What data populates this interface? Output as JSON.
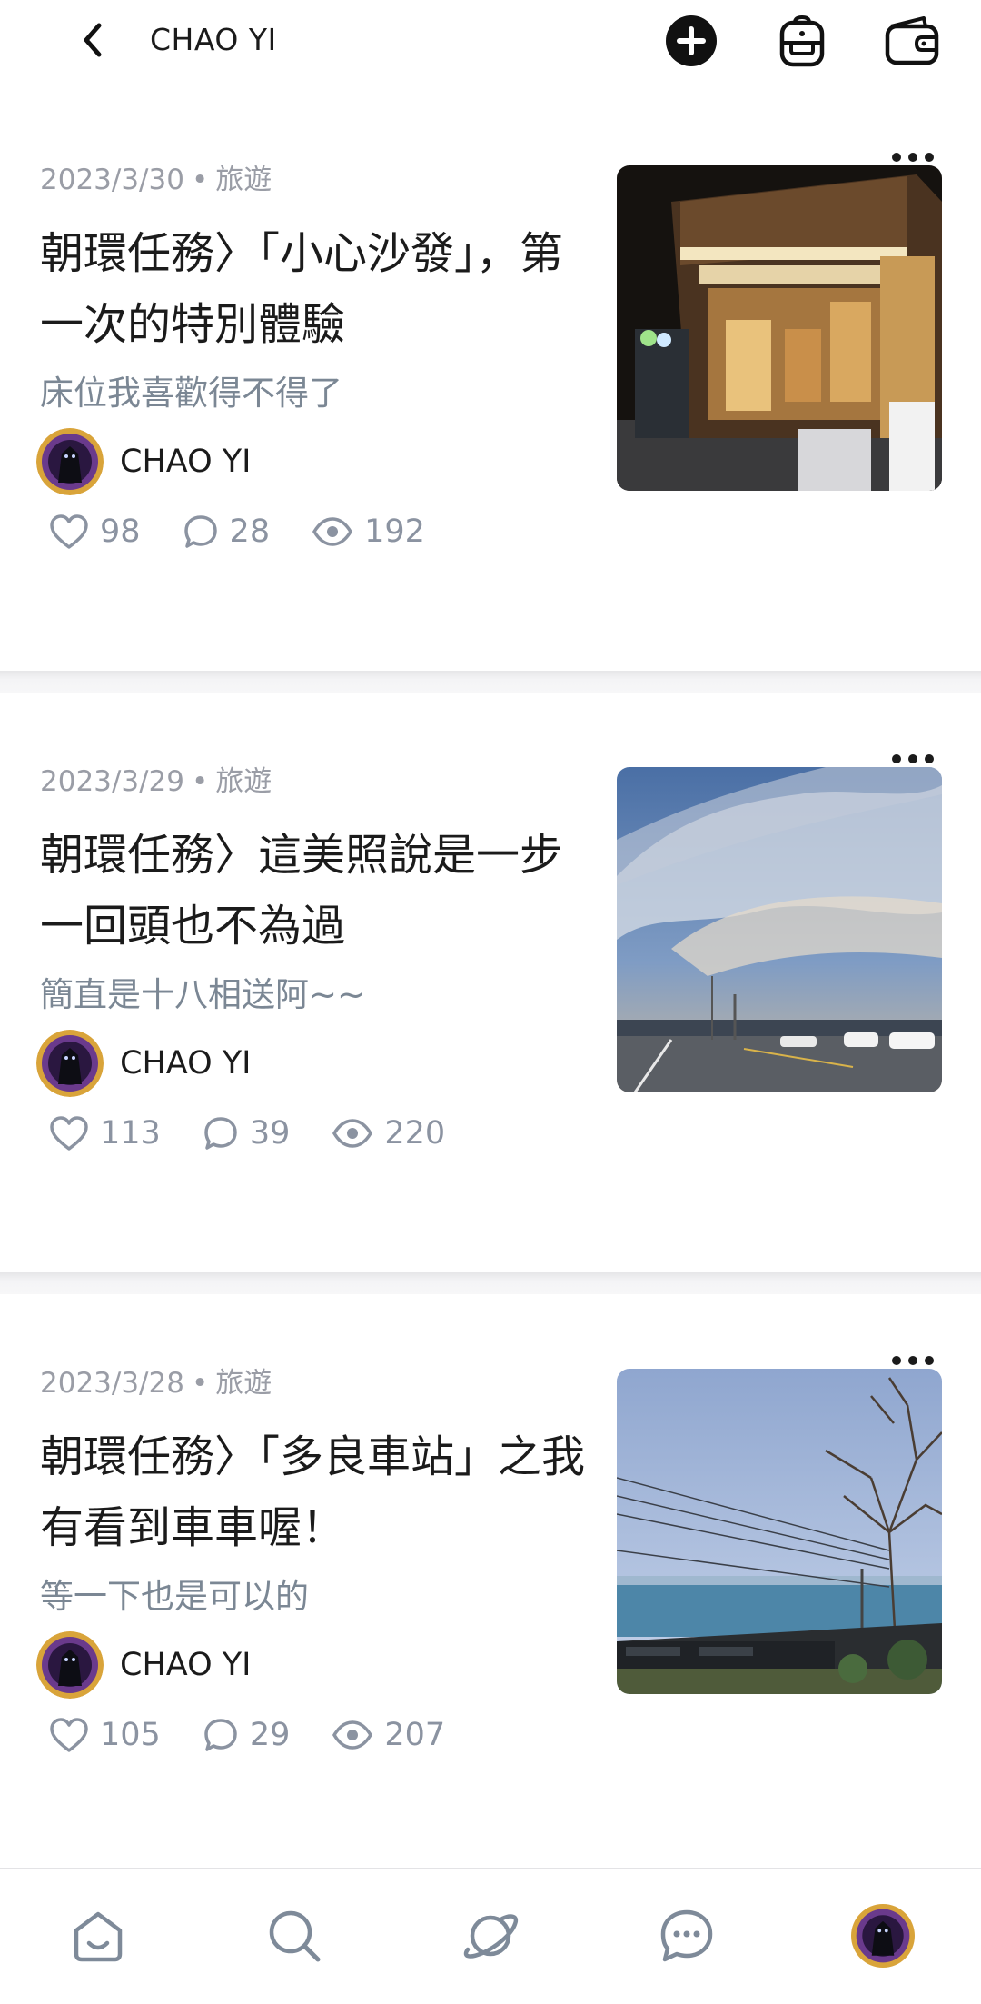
{
  "header": {
    "title": "CHAO YI",
    "icons": [
      "back-icon",
      "add-post-icon",
      "backpack-icon",
      "wallet-icon"
    ]
  },
  "posts": [
    {
      "date": "2023/3/30",
      "separator": "•",
      "category": "旅遊",
      "title": "朝環任務〉「小心沙發」，第一次的特別體驗",
      "subtitle": "床位我喜歡得不得了",
      "author": "CHAO YI",
      "likes": "98",
      "comments": "28",
      "views": "192"
    },
    {
      "date": "2023/3/29",
      "separator": "•",
      "category": "旅遊",
      "title": "朝環任務〉這美照說是一步一回頭也不為過",
      "subtitle": "簡直是十八相送阿~~",
      "author": "CHAO YI",
      "likes": "113",
      "comments": "39",
      "views": "220"
    },
    {
      "date": "2023/3/28",
      "separator": "•",
      "category": "旅遊",
      "title": "朝環任務〉「多良車站」之我有看到車車喔！",
      "subtitle": "等一下也是可以的",
      "author": "CHAO YI",
      "likes": "105",
      "comments": "29",
      "views": "207"
    }
  ],
  "bottom_nav": [
    "home-icon",
    "search-icon",
    "explore-planet-icon",
    "messages-icon",
    "profile-avatar"
  ],
  "colors": {
    "meta_text": "#9a9da6",
    "subtitle_text": "#7b8794",
    "stat_text": "#8b93a1",
    "separator": "#f0f0f2"
  }
}
